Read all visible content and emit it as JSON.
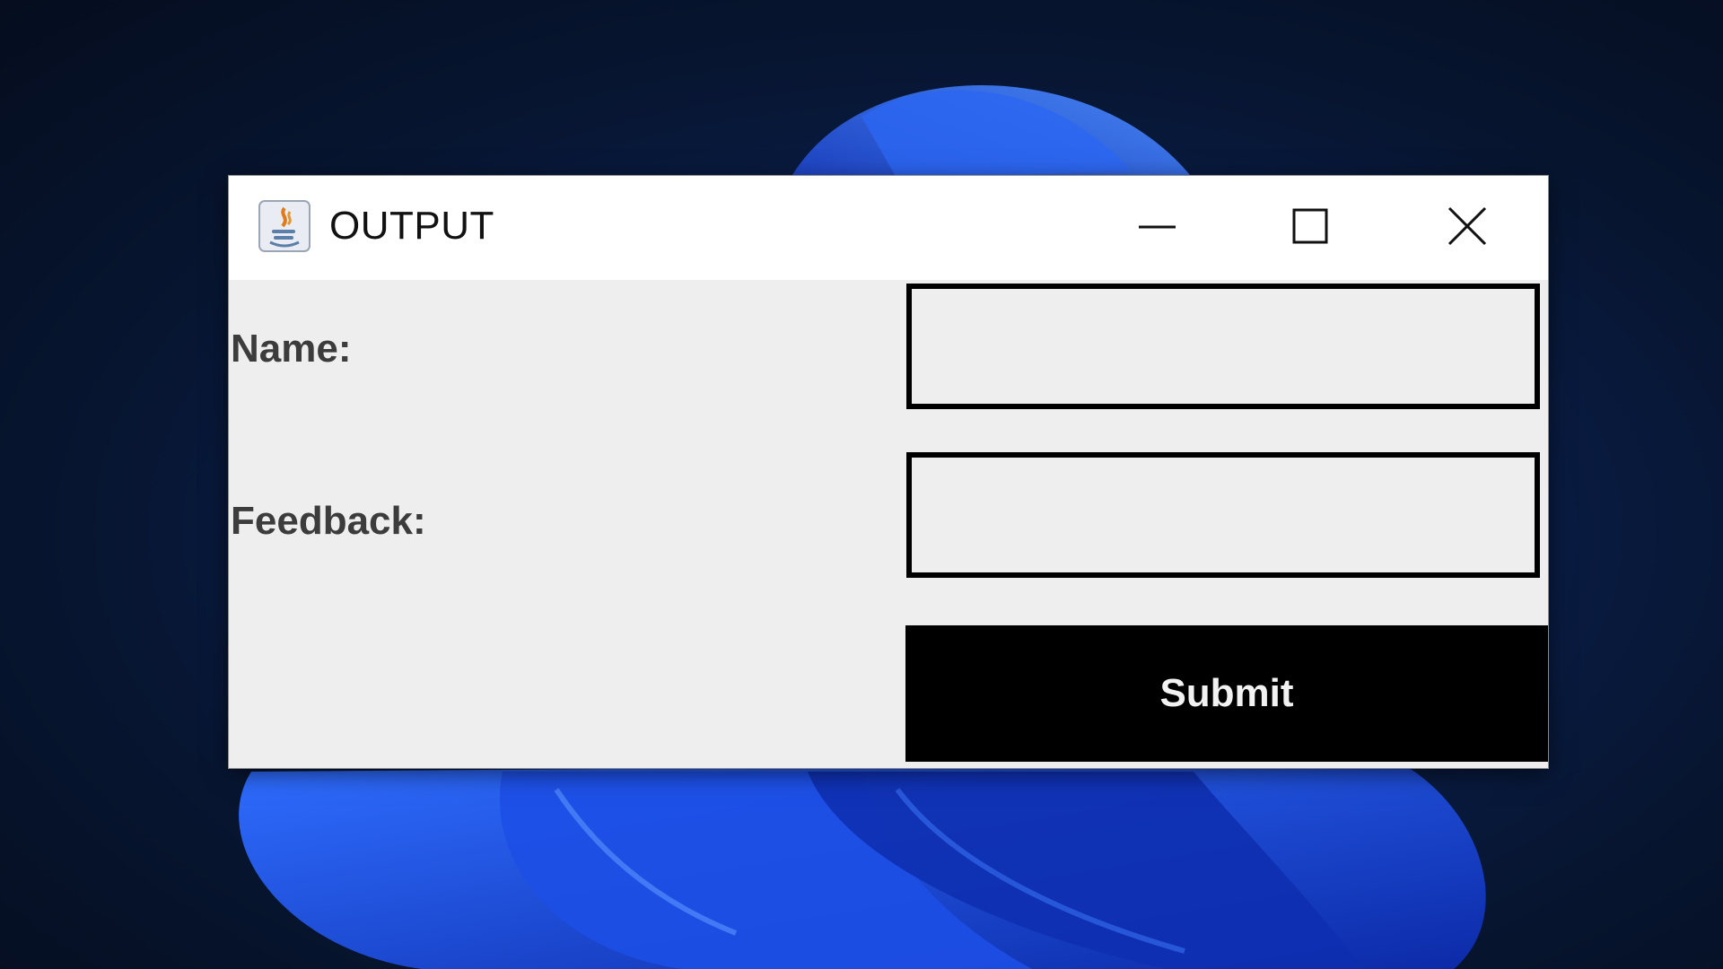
{
  "window": {
    "title": "OUTPUT",
    "app_icon": "java-icon",
    "controls": {
      "minimize_icon": "minimize-icon",
      "maximize_icon": "maximize-icon",
      "close_icon": "close-icon"
    }
  },
  "form": {
    "name_label": "Name:",
    "name_value": "",
    "feedback_label": "Feedback:",
    "feedback_value": "",
    "submit_label": "Submit"
  },
  "colors": {
    "desktop_background": "#071530",
    "wallpaper_bloom": "#1b4fe0",
    "window_background": "#eeeeee",
    "titlebar_background": "#ffffff",
    "field_border": "#000000",
    "button_background": "#000000",
    "button_text": "#f2f2f2",
    "label_text": "#3c3c3c"
  }
}
